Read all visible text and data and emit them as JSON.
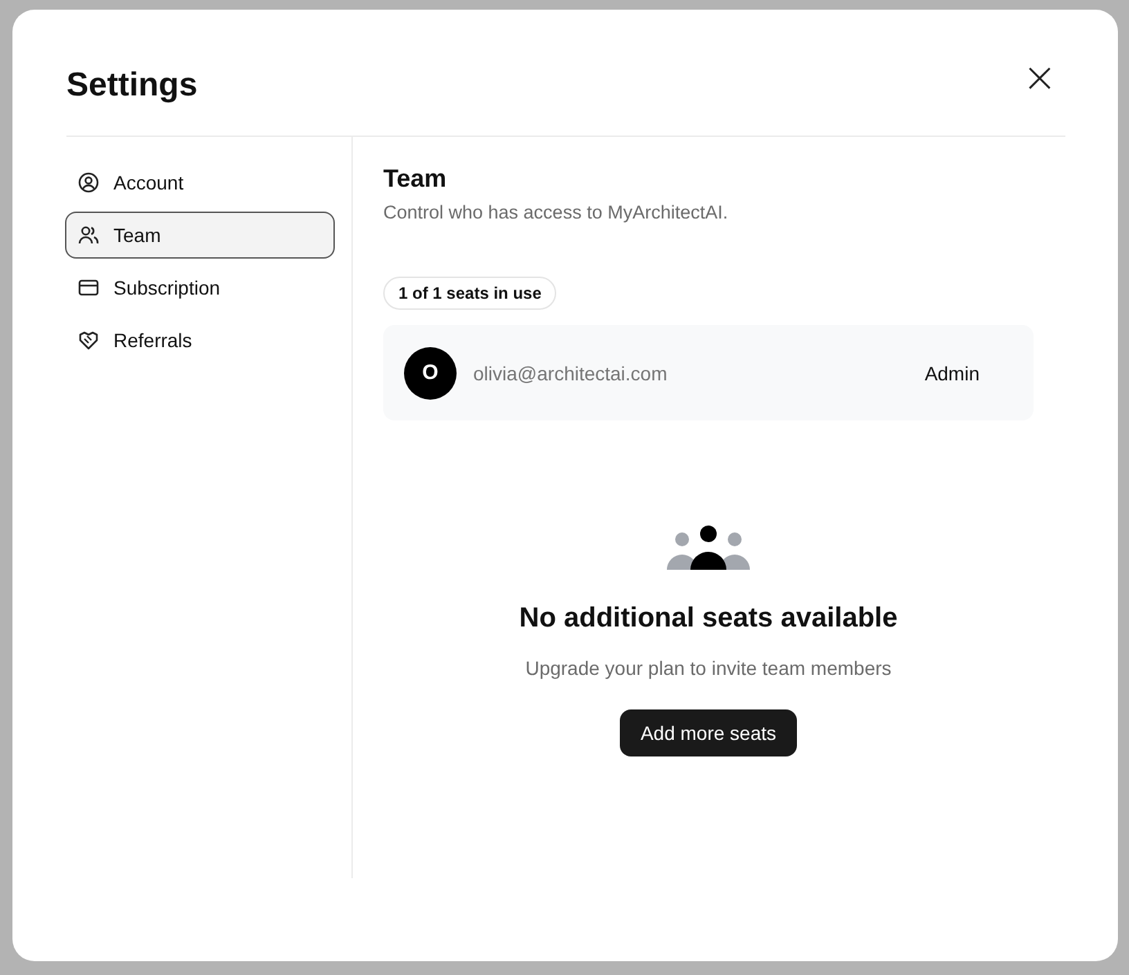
{
  "dialog": {
    "title": "Settings",
    "close_label": "×"
  },
  "sidebar": {
    "items": [
      {
        "label": "Account",
        "selected": false
      },
      {
        "label": "Team",
        "selected": true
      },
      {
        "label": "Subscription",
        "selected": false
      },
      {
        "label": "Referrals",
        "selected": false
      }
    ]
  },
  "panel": {
    "title": "Team",
    "subtitle": "Control who has access to MyArchitectAI.",
    "seats_badge": "1 of 1 seats in use",
    "members": [
      {
        "initial": "O",
        "email": "olivia@architectai.com",
        "role": "Admin"
      }
    ],
    "empty_state": {
      "title": "No additional seats available",
      "message": "Upgrade your plan to invite team members",
      "button": "Add more seats"
    }
  }
}
